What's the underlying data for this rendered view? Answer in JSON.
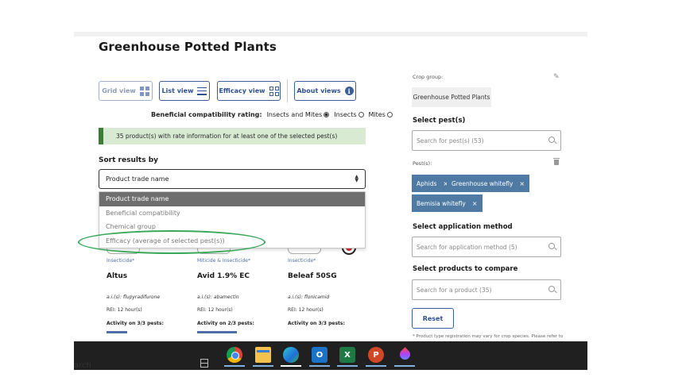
{
  "page": {
    "title": "Greenhouse Potted Plants"
  },
  "views": {
    "grid": "Grid view",
    "list": "List view",
    "efficacy": "Efficacy view",
    "about": "About views"
  },
  "compat": {
    "label": "Beneficial compatibility rating:",
    "opt1": "Insects and Mites",
    "opt2": "Insects",
    "opt3": "Mites",
    "selected": "Insects and Mites"
  },
  "notice": "35 product(s) with rate information for at least one of the selected pest(s)",
  "sort": {
    "label": "Sort results by",
    "value": "Product trade name",
    "options": [
      "Product trade name",
      "Beneficial compatibility",
      "Chemical group",
      "Efficacy (average of selected pest(s))"
    ]
  },
  "cards": [
    {
      "type": "Insecticide*",
      "name": "Altus",
      "ai": "a.i.(s): flupyradifurone",
      "rei": "REI: 12 hour(s)",
      "activity": "Activity on 3/3 pests:"
    },
    {
      "type": "Miticide & Insecticide*",
      "name": "Avid 1.9% EC",
      "ai": "a.i.(s): abamectin",
      "rei": "REI: 12 hour(s)",
      "activity": "Activity on 2/3 pests:"
    },
    {
      "type": "Insecticide*",
      "name": "Beleaf 50SG",
      "ai": "a.i.(s): flonicamid",
      "rei": "REI: 12 hour(s)",
      "activity": "Activity on 3/3 pests:"
    }
  ],
  "right": {
    "crop_group_label": "Crop group:",
    "crop_group_value": "Greenhouse Potted Plants",
    "pest_title": "Select pest(s)",
    "pest_placeholder": "Search for pest(s) (53)",
    "pests_label": "Pest(s):",
    "pests": [
      "Aphids",
      "Greenhouse whitefly",
      "Bemisia whitefly"
    ],
    "remove_glyph": "×",
    "method_title": "Select application method",
    "method_placeholder": "Search for application method (5)",
    "compare_title": "Select products to compare",
    "compare_placeholder": "Search for a product (35)",
    "reset": "Reset",
    "footnote": "* Product type registration may vary for crop species. Please refer to"
  },
  "taskbar": {
    "search_fragment": "arch",
    "apps": [
      "chrome-icon",
      "file-explorer-icon",
      "edge-icon",
      "outlook-icon",
      "excel-icon",
      "powerpoint-icon",
      "paint-drop-icon"
    ],
    "outlook_letter": "O",
    "excel_letter": "X",
    "ppt_letter": "P"
  },
  "colors": {
    "accent": "#3d5f97",
    "notice_bg": "#d8ebd2",
    "notice_bar": "#3f7c3a",
    "tag": "#4e7aa3",
    "highlight": "#3aa75a"
  }
}
